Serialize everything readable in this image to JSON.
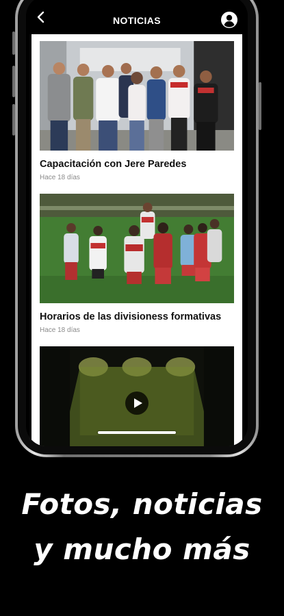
{
  "header": {
    "title": "NOTICIAS",
    "back_icon": "chevron-left-icon",
    "profile_icon": "user-circle-icon"
  },
  "news": [
    {
      "title": "Capacitación con Jere Paredes",
      "date": "Hace 18 días"
    },
    {
      "title": "Horarios de las divisioness formativas",
      "date": "Hace 18 días"
    },
    {
      "title": "",
      "date": "",
      "media": "video"
    }
  ],
  "promo": {
    "line1": "Fotos, noticias",
    "line2": "y mucho más"
  },
  "colors": {
    "background": "#000000",
    "header": "#000000",
    "content": "#ffffff",
    "title_text": "#111111",
    "date_text": "#8a8a8a"
  }
}
